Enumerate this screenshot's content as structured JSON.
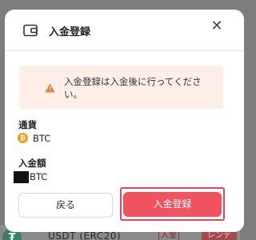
{
  "background": {
    "coin_symbol": "₮",
    "asset_label": "USDT (ERC20)",
    "deposit_button": "入金",
    "lend_button": "レンデ"
  },
  "modal": {
    "title": "入金登録",
    "notice": "入金登録は入金後に行ってください。",
    "currency_label": "通貨",
    "currency_value": "BTC",
    "currency_icon_symbol": "₿",
    "amount_label": "入金額",
    "amount_value": "BTC",
    "back_button": "戻る",
    "submit_button": "入金登録"
  },
  "colors": {
    "accent": "#f0535f",
    "notice_bg": "#fdefe7",
    "warning": "#f07a3a",
    "btc": "#f0a020"
  }
}
